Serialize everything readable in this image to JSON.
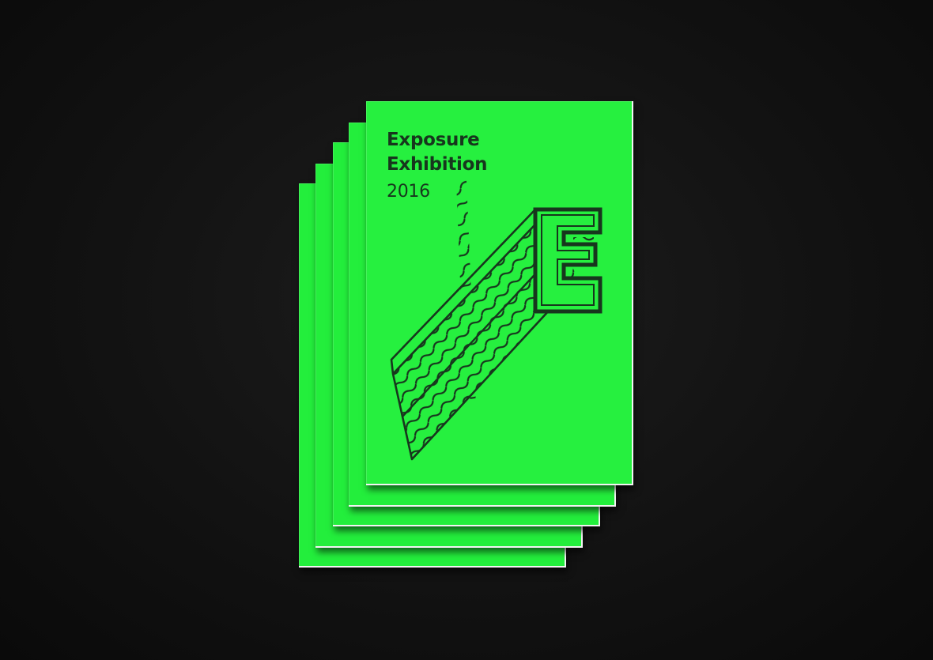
{
  "booklet": {
    "title_line1": "Exposure",
    "title_line2": "Exhibition",
    "year": "2016",
    "logo_letter": "E"
  },
  "colors": {
    "background": "#121212",
    "cover": "#26f03f",
    "ink": "#17361d",
    "page_edge": "#f3f3f3"
  }
}
